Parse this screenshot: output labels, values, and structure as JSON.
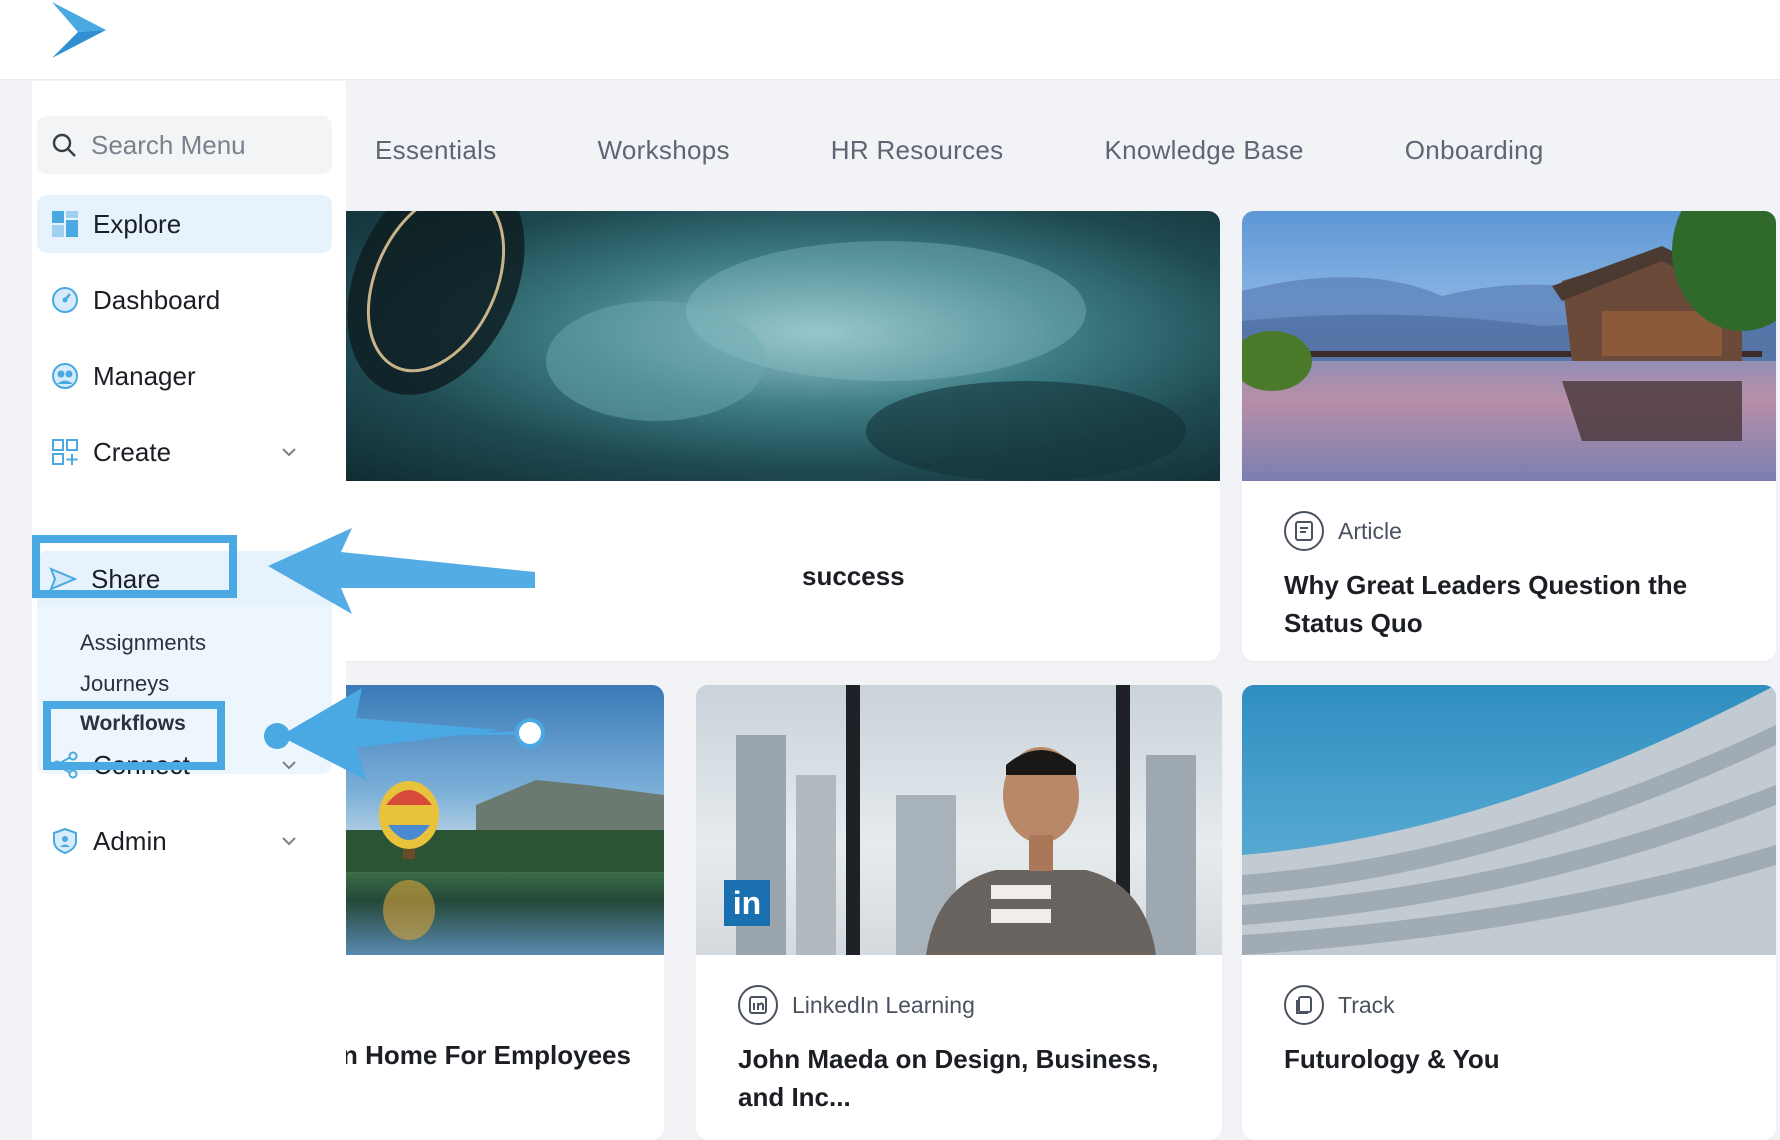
{
  "brand": {
    "accent": "#4aa8e2",
    "active_bg": "#e6f3fc"
  },
  "search": {
    "placeholder": "Search Menu",
    "icon": "search-icon"
  },
  "sidebar": {
    "items": [
      {
        "label": "Explore",
        "icon": "explore-grid-icon",
        "active": true
      },
      {
        "label": "Dashboard",
        "icon": "dashboard-gauge-icon"
      },
      {
        "label": "Manager",
        "icon": "manager-people-icon"
      },
      {
        "label": "Create",
        "icon": "create-plus-grid-icon",
        "expandable": true
      },
      {
        "label": "Share",
        "icon": "share-send-icon",
        "expanded": true
      },
      {
        "label": "Connect",
        "icon": "connect-nodes-icon",
        "expandable": true
      },
      {
        "label": "Admin",
        "icon": "admin-shield-icon",
        "expandable": true
      }
    ],
    "share_submenu": [
      "Assignments",
      "Journeys",
      "Workflows"
    ]
  },
  "tabs": [
    "Essentials",
    "Workshops",
    "HR Resources",
    "Knowledge Base",
    "Onboarding"
  ],
  "cards": [
    {
      "type": "",
      "title": "success",
      "image": "underwater-abstract"
    },
    {
      "type": "Article",
      "type_icon": "article-icon",
      "title": "Why Great Leaders Question the Status Quo",
      "image": "lake-house"
    },
    {
      "type": "",
      "title": "n Home For Employees",
      "image": "hot-air-balloon-lake"
    },
    {
      "type": "LinkedIn Learning",
      "type_icon": "linkedin-icon",
      "title": "John Maeda on Design, Business, and Inc...",
      "image": "man-portrait",
      "badge": "in"
    },
    {
      "type": "Track",
      "type_icon": "track-icon",
      "title": "Futurology & You",
      "image": "architecture-facade"
    }
  ]
}
